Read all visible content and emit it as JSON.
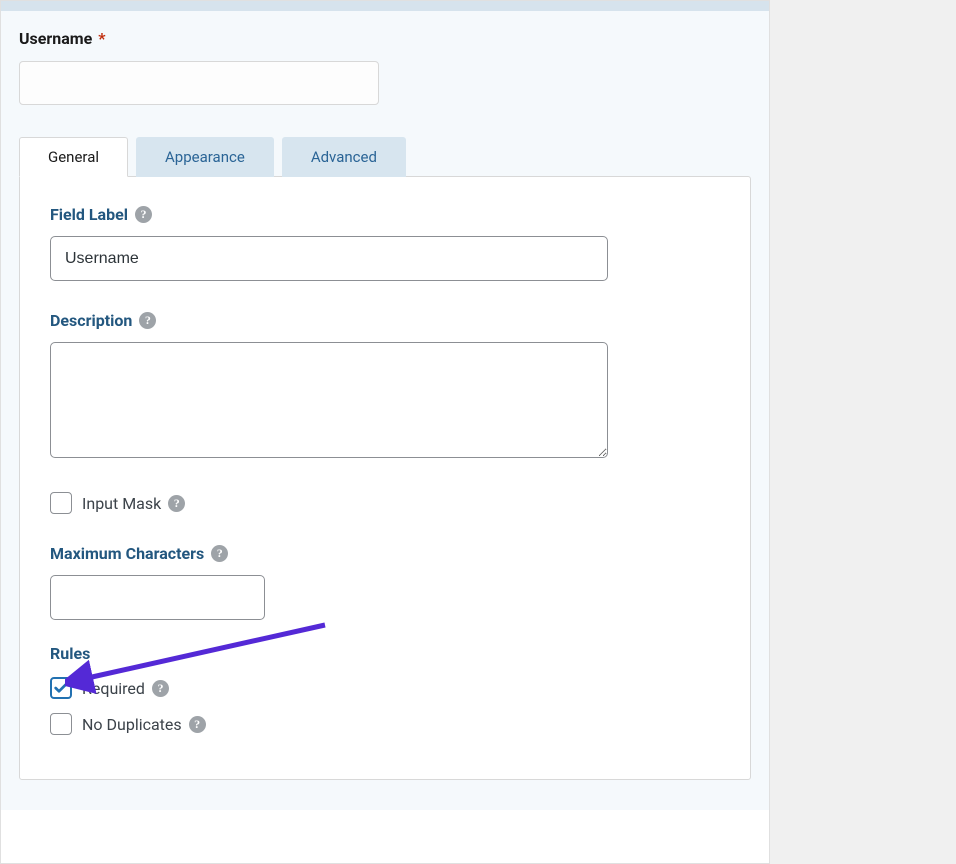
{
  "preview": {
    "label": "Username",
    "required_mark": "*"
  },
  "tabs": {
    "general": "General",
    "appearance": "Appearance",
    "advanced": "Advanced"
  },
  "general": {
    "field_label_heading": "Field Label",
    "field_label_value": "Username",
    "description_heading": "Description",
    "description_value": "",
    "input_mask_label": "Input Mask",
    "max_chars_heading": "Maximum Characters",
    "max_chars_value": "",
    "rules_heading": "Rules",
    "required_label": "Required",
    "no_duplicates_label": "No Duplicates"
  }
}
